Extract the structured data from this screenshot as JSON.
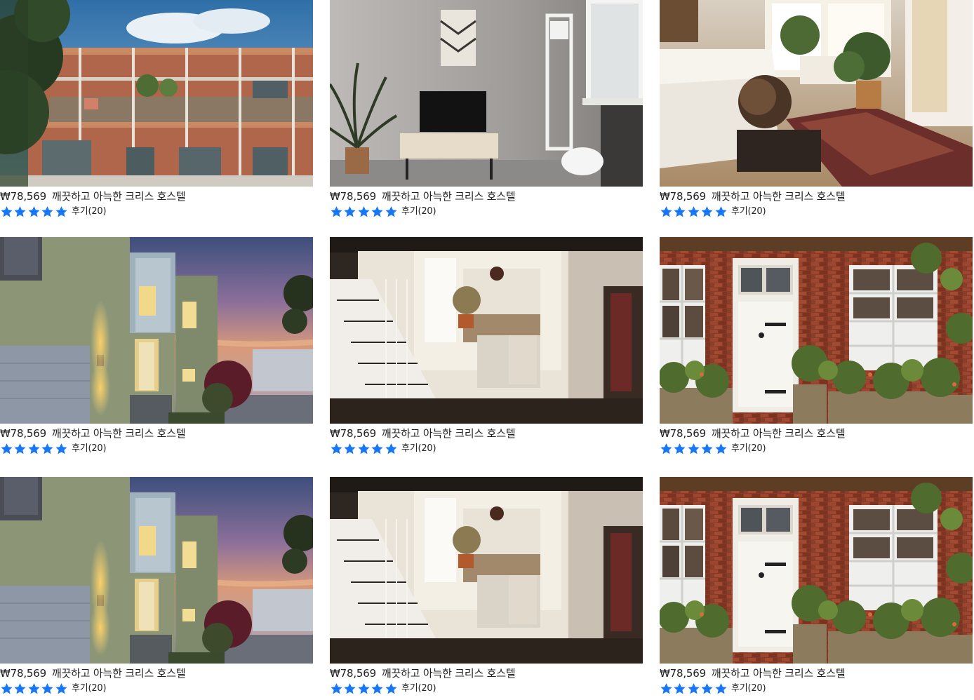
{
  "colors": {
    "star": "#1877f2",
    "text": "#222222",
    "background": "#ffffff"
  },
  "listings": [
    {
      "image": "apartment-balconies-photo",
      "price": "₩78,569",
      "name": "깨끗하고 아늑한 크리스 호스텔",
      "rating": 5,
      "reviews": "후기(20)"
    },
    {
      "image": "living-room-tv-photo",
      "price": "₩78,569",
      "name": "깨끗하고 아늑한 크리스 호스텔",
      "rating": 5,
      "reviews": "후기(20)"
    },
    {
      "image": "bedroom-globe-photo",
      "price": "₩78,569",
      "name": "깨끗하고 아늑한 크리스 호스텔",
      "rating": 5,
      "reviews": "후기(20)"
    },
    {
      "image": "modern-house-dusk-photo",
      "price": "₩78,569",
      "name": "깨끗하고 아늑한 크리스 호스텔",
      "rating": 5,
      "reviews": "후기(20)"
    },
    {
      "image": "loft-staircase-photo",
      "price": "₩78,569",
      "name": "깨끗하고 아늑한 크리스 호스텔",
      "rating": 5,
      "reviews": "후기(20)"
    },
    {
      "image": "brick-house-white-door-photo",
      "price": "₩78,569",
      "name": "깨끗하고 아늑한 크리스 호스텔",
      "rating": 5,
      "reviews": "후기(20)"
    },
    {
      "image": "modern-house-dusk-photo",
      "price": "₩78,569",
      "name": "깨끗하고 아늑한 크리스 호스텔",
      "rating": 5,
      "reviews": "후기(20)"
    },
    {
      "image": "loft-staircase-photo",
      "price": "₩78,569",
      "name": "깨끗하고 아늑한 크리스 호스텔",
      "rating": 5,
      "reviews": "후기(20)"
    },
    {
      "image": "brick-house-white-door-photo",
      "price": "₩78,569",
      "name": "깨끗하고 아늑한 크리스 호스텔",
      "rating": 5,
      "reviews": "후기(20)"
    }
  ]
}
